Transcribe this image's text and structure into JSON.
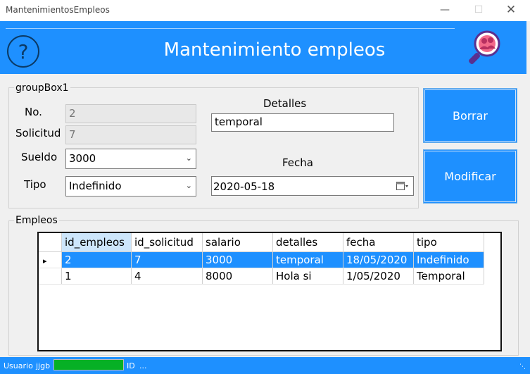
{
  "window": {
    "title": "MantenimientosEmpleos"
  },
  "header": {
    "title": "Mantenimiento empleos",
    "help_glyph": "?",
    "accent": "#1e90ff"
  },
  "form": {
    "groupbox_label": "groupBox1",
    "no_label": "No.",
    "no_value": "2",
    "solicitud_label": "Solicitud",
    "solicitud_value": "7",
    "sueldo_label": "Sueldo",
    "sueldo_value": "3000",
    "tipo_label": "Tipo",
    "tipo_value": "Indefinido",
    "detalles_label": "Detalles",
    "detalles_value": "temporal",
    "fecha_label": "Fecha",
    "fecha_value": "2020-05-18"
  },
  "buttons": {
    "delete_label": "Borrar",
    "modify_label": "Modificar"
  },
  "grid": {
    "groupbox_label": "Empleos",
    "columns": [
      "id_empleos",
      "id_solicitud",
      "salario",
      "detalles",
      "fecha",
      "tipo"
    ],
    "rows": [
      [
        "2",
        "7",
        "3000",
        "temporal",
        "18/05/2020",
        "Indefinido"
      ],
      [
        "1",
        "4",
        "8000",
        "Hola si",
        "1/05/2020",
        "Temporal"
      ]
    ],
    "selected_row_marker": "▸"
  },
  "status": {
    "usuario_label": "Usuario",
    "usuario_value": "jjgb",
    "progress": 1.0,
    "id_label": "ID",
    "id_value": "..."
  }
}
